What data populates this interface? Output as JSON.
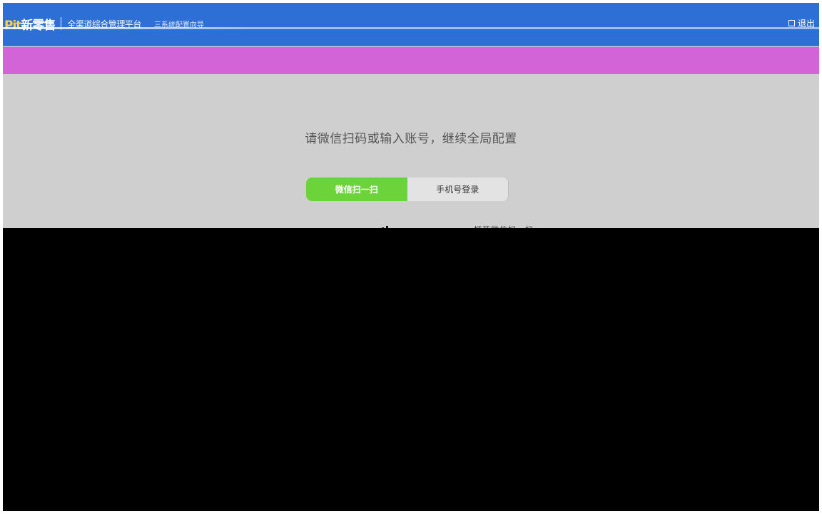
{
  "header": {
    "brand_logo_prefix": "Pit",
    "brand_logo_main": "新零售",
    "brand_subtitle": "全渠道综合管理平台",
    "version": "三系统配置向导",
    "logout_label": "退出"
  },
  "login": {
    "prompt": "请微信扫码或输入账号，继续全局配置",
    "tabs": [
      {
        "label": "微信扫一扫",
        "active": true
      },
      {
        "label": "手机号登录",
        "active": false
      }
    ],
    "qr_caption": "打开微信扫一扫"
  },
  "colors": {
    "topbar": "#2e6fd6",
    "banner": "#d264d8",
    "background": "#cfcfcf",
    "active_tab": "#6cd33a",
    "inactive_tab": "#e3e3e3",
    "overlay": "#000000"
  },
  "icons": {
    "logout": "logout-icon"
  }
}
